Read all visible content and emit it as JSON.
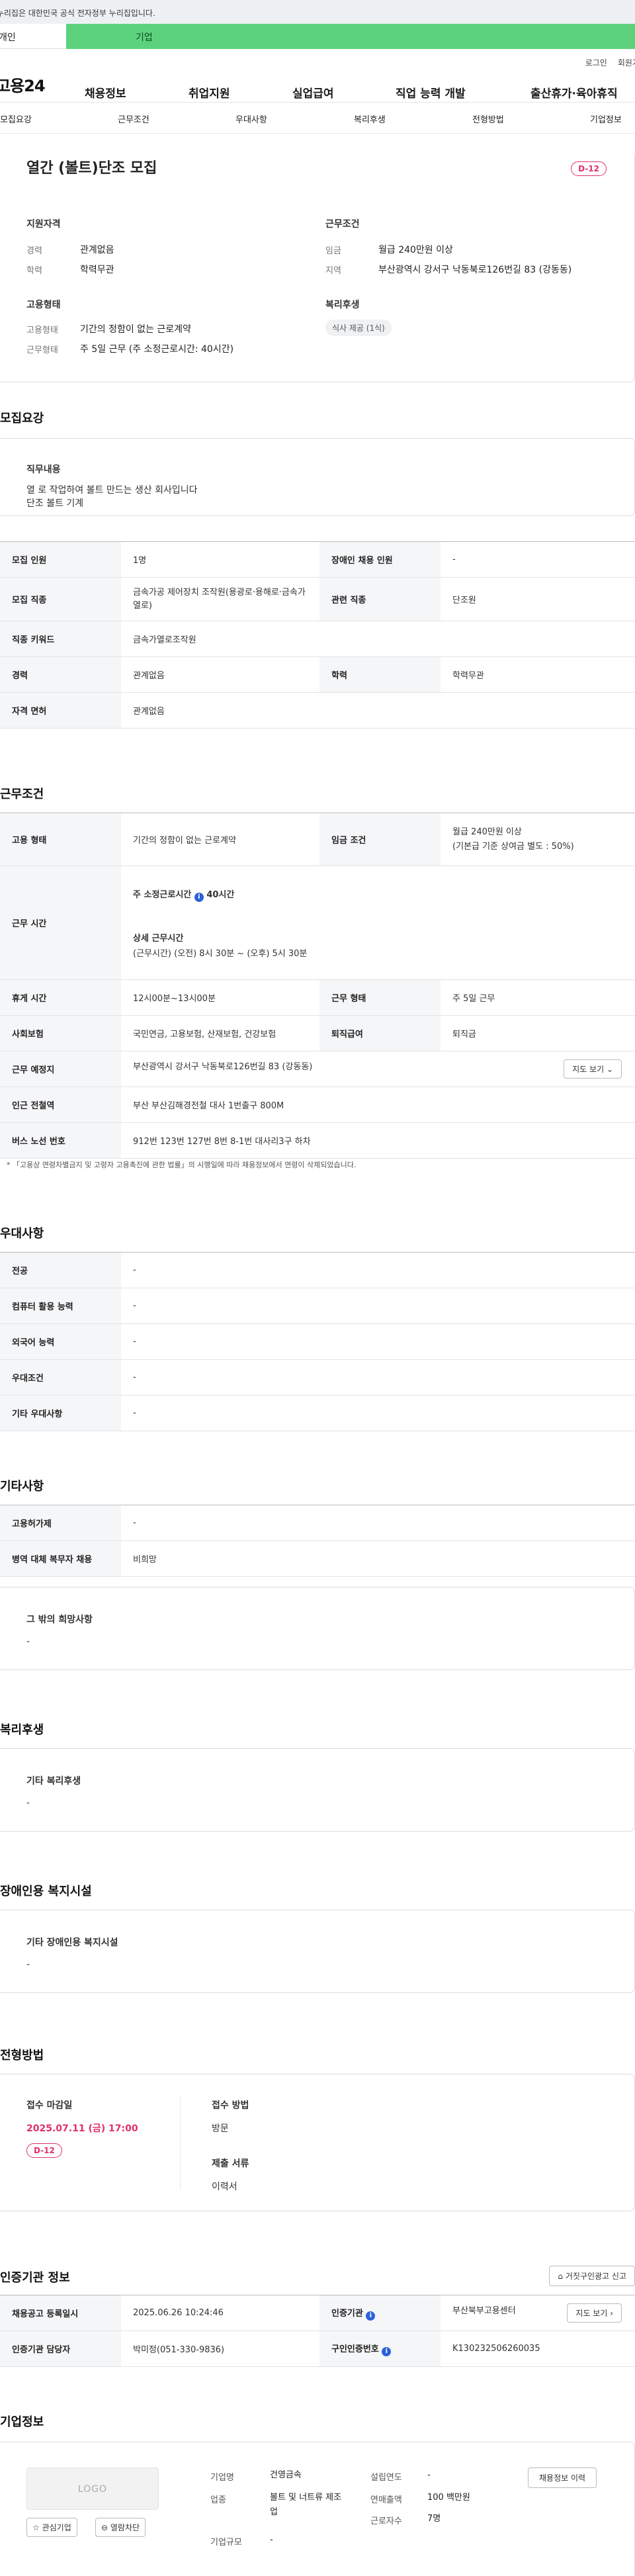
{
  "notice": "이 누리집은 대한민국 공식 전자정부 누리집입니다.",
  "user_tabs": [
    "개인",
    "기업"
  ],
  "util": [
    "로그인",
    "회원가입"
  ],
  "logo": "고용24",
  "gnb": [
    "채용정보",
    "취업지원",
    "실업급여",
    "직업 능력 개발",
    "출산휴가·육아휴직"
  ],
  "subtabs": [
    "모집요강",
    "근무조건",
    "우대사항",
    "복리후생",
    "전형방법",
    "기업정보"
  ],
  "summary": {
    "title": "열간 (볼트)단조 모집",
    "dday": "D-12",
    "qual_h": "지원자격",
    "qual_rows": [
      [
        "경력",
        "관계없음"
      ],
      [
        "학력",
        "학력무관"
      ]
    ],
    "cond_h": "근무조건",
    "cond_rows": [
      [
        "임금",
        "월급 240만원 이상"
      ],
      [
        "지역",
        "부산광역시 강서구 낙동북로126번길 83 (강동동)"
      ]
    ],
    "emp_h": "고용형태",
    "emp_rows": [
      [
        "고용형태",
        "기간의 정함이 없는 근로계약"
      ],
      [
        "근무형태",
        "주 5일 근무 (주 소정근로시간: 40시간)"
      ]
    ],
    "welfare_h": "복리후생",
    "welfare_chip": "식사 제공 (1식)"
  },
  "recruit": {
    "title": "모집요강",
    "duty_h": "직무내용",
    "duty_lines": [
      "열 로 작업하여 볼트 만드는 생산 회사입니다",
      "단조 볼트 기계"
    ],
    "rows": [
      {
        "k1": "모집 인원",
        "v1": "1명",
        "k2": "장애인 채용 인원",
        "v2": "-"
      },
      {
        "k1": "모집 직종",
        "v1": "금속가공 제어장치 조작원(용광로·용해로·금속가열로)",
        "k2": "관련 직종",
        "v2": "단조원"
      },
      {
        "k1": "직종 키워드",
        "v1": "금속가열로조작원"
      },
      {
        "k1": "경력",
        "v1": "관계없음",
        "k2": "학력",
        "v2": "학력무관"
      },
      {
        "k1": "자격 면허",
        "v1": "관계없음"
      }
    ]
  },
  "work": {
    "title": "근무조건",
    "emp_type_k": "고용 형태",
    "emp_type_v": "기간의 정함이 없는 근로계약",
    "wage_k": "임금 조건",
    "wage_v1": "월급 240만원 이상",
    "wage_v2": "(기본급 기준 상여금 별도 : 50%)",
    "hours_k": "근무 시간",
    "hours_a": "주 소정근로시간",
    "hours_a_val": "40시간",
    "hours_b": "상세 근무시간",
    "hours_b_val": "(근무시간) (오전) 8시 30분 ~ (오후) 5시 30분",
    "break_k": "휴게 시간",
    "break_v": "12시00분~13시00분",
    "shape_k": "근무 형태",
    "shape_v": "주 5일 근무",
    "ins_k": "사회보험",
    "ins_v": "국민연금, 고용보험, 산재보험, 건강보험",
    "ret_k": "퇴직급여",
    "ret_v": "퇴직금",
    "place_k": "근무 예정지",
    "place_v": "부산광역시 강서구 낙동북로126번길 83 (강동동)",
    "map_btn": "지도 보기 ⌄",
    "subway_k": "인근 전철역",
    "subway_v": "부산 부산김해경전철 대사 1번출구 800M",
    "bus_k": "버스 노선 번호",
    "bus_v": "912번 123번 127번 8번 8-1번 대사리3구 하차",
    "footnote": "* 「고용상 연령차별금지 및 고령자 고용촉진에 관한 법률」의 시행일에 따라 채용정보에서 연령이 삭제되었습니다."
  },
  "pref": {
    "title": "우대사항",
    "rows": [
      [
        "전공",
        "-"
      ],
      [
        "컴퓨터 활용 능력",
        "-"
      ],
      [
        "외국어 능력",
        "-"
      ],
      [
        "우대조건",
        "-"
      ],
      [
        "기타 우대사항",
        "-"
      ]
    ]
  },
  "etc": {
    "title": "기타사항",
    "rows": [
      [
        "고용허가제",
        "-"
      ],
      [
        "병역 대체 복무자 채용",
        "비희망"
      ]
    ],
    "box_h": "그 밖의 희망사항",
    "box_v": "-"
  },
  "welfare": {
    "title": "복리후생",
    "box_h": "기타 복리후생",
    "box_v": "-"
  },
  "disabled": {
    "title": "장애인용 복지시설",
    "box_h": "기타 장애인용 복지시설",
    "box_v": "-"
  },
  "selection": {
    "title": "전형방법",
    "deadline_h": "접수 마감일",
    "deadline_v": "2025.07.11 (금) 17:00",
    "dday": "D-12",
    "method_h": "접수 방법",
    "method_v": "방문",
    "docs_h": "제출 서류",
    "docs_v": "이력서"
  },
  "agency": {
    "title": "인증기관 정보",
    "report_btn": "거짓구인광고 신고",
    "r1k1": "채용공고 등록일시",
    "r1v1": "2025.06.26 10:24:46",
    "r1k2": "인증기관",
    "r1v2": "부산북부고용센터",
    "map_btn": "지도 보기 ›",
    "r2k1": "인증기관 담당자",
    "r2v1": "박미정(051-330-9836)",
    "r2k2": "구인인증번호",
    "r2v2": "K130232506260035"
  },
  "company": {
    "title": "기업정보",
    "logo": "LOGO",
    "fav_btn": "☆ 관심기업",
    "block_btn": "⊖ 열람차단",
    "name_k": "기업명",
    "name_v": "건영금속",
    "ind_k": "업종",
    "ind_v": "볼트 및 너트류 제조업",
    "size_k": "기업규모",
    "size_v": "-",
    "est_k": "설립연도",
    "est_v": "-",
    "sales_k": "연매출액",
    "sales_v": "100 백만원",
    "emp_k": "근로자수",
    "emp_v": "7명",
    "hist_btn": "채용정보 이력"
  }
}
